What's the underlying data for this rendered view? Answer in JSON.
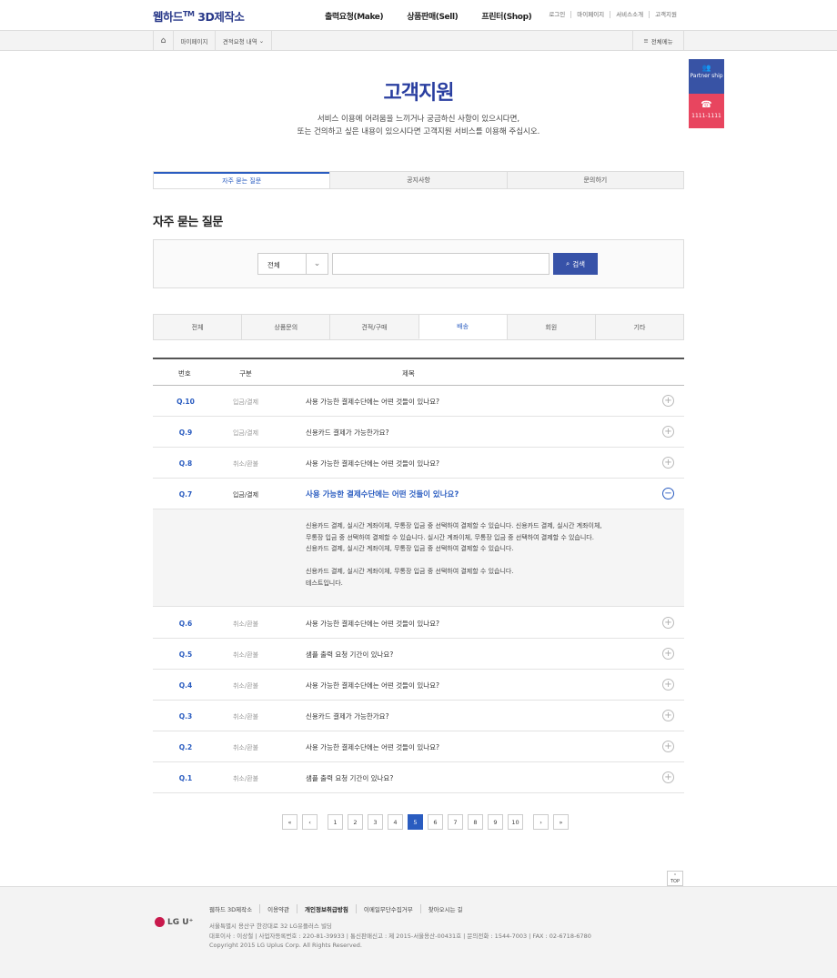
{
  "header": {
    "logo_main": "웹하드",
    "logo_tm": "TM",
    "logo_sub": "3D제작소",
    "gnb": [
      "출력요청(Make)",
      "상품판매(Sell)",
      "프린터(Shop)"
    ],
    "util": [
      "로그인",
      "마이페이지",
      "서비스소개",
      "고객지원"
    ]
  },
  "subbar": {
    "crumb1": "마이페이지",
    "crumb2": "견적요청 내역",
    "allmenu": "전체메뉴"
  },
  "side": {
    "partner": "Partner ship",
    "phone": "1111-1111"
  },
  "page": {
    "title": "고객지원",
    "desc1": "서비스 이용에 어려움을 느끼거나 궁금하신 사항이 있으시다면,",
    "desc2": "또는 건의하고 싶은 내용이 있으시다면 고객지원 서비스를 이용해 주십시오."
  },
  "tabs": [
    "자주 묻는 질문",
    "공지사항",
    "문의하기"
  ],
  "section_title": "자주 묻는 질문",
  "search": {
    "select_value": "전체",
    "input_value": "",
    "button": "검색"
  },
  "categories": [
    "전체",
    "상품문의",
    "견적/구매",
    "배송",
    "회원",
    "기타"
  ],
  "table": {
    "headers": [
      "번호",
      "구분",
      "제목"
    ],
    "rows": [
      {
        "no": "Q.10",
        "cat": "입금/결제",
        "q": "사용 가능한 결제수단에는 어떤 것들이 있나요?"
      },
      {
        "no": "Q.9",
        "cat": "입금/결제",
        "q": "신용카드 결제가 가능한가요?"
      },
      {
        "no": "Q.8",
        "cat": "취소/환불",
        "q": "사용 가능한 결제수단에는 어떤 것들이 있나요?"
      },
      {
        "no": "Q.7",
        "cat": "입금/결제",
        "q": "사용 가능한 결제수단에는 어떤 것들이 있나요?"
      },
      {
        "no": "Q.6",
        "cat": "취소/환불",
        "q": "사용 가능한 결제수단에는 어떤 것들이 있나요?"
      },
      {
        "no": "Q.5",
        "cat": "취소/환불",
        "q": "샘플 출력 요청 기간이 있나요?"
      },
      {
        "no": "Q.4",
        "cat": "취소/환불",
        "q": "사용 가능한 결제수단에는 어떤 것들이 있나요?"
      },
      {
        "no": "Q.3",
        "cat": "취소/환불",
        "q": "신용카드 결제가 가능한가요?"
      },
      {
        "no": "Q.2",
        "cat": "취소/환불",
        "q": "사용 가능한 결제수단에는 어떤 것들이 있나요?"
      },
      {
        "no": "Q.1",
        "cat": "취소/환불",
        "q": "샘플 출력 요청 기간이 있나요?"
      }
    ],
    "answer_lines": [
      "신용카드 결제, 실시간 계좌이체, 무통장 입금 중 선택하여 결제할 수 있습니다. 신용카드 결제, 실시간 계좌이체,",
      "무통장 입금 중 선택하여 결제할 수 있습니다. 실시간 계좌이체, 무통장 입금 중 선택하여 결제할 수 있습니다.",
      "신용카드 결제, 실시간 계좌이체, 무통장 입금 중 선택하여 결제할 수 있습니다.",
      "신용카드 결제, 실시간 계좌이체, 무통장 입금 중 선택하여 결제할 수 있습니다.",
      "테스트입니다."
    ]
  },
  "pager": {
    "pages": [
      "1",
      "2",
      "3",
      "4",
      "5",
      "6",
      "7",
      "8",
      "9",
      "10"
    ],
    "current": "5",
    "first": "«",
    "prev": "‹",
    "next": "›",
    "last": "»"
  },
  "top_label": "TOP",
  "footer": {
    "logo": "LG U⁺",
    "links": [
      "웹하드 3D제작소",
      "이용약관",
      "개인정보취급방침",
      "이메일무단수집거부",
      "찾아오시는 길"
    ],
    "addr1": "서울특별시 용산구 한강대로 32 LG유플러스 빌딩",
    "addr2": "대표이사 : 이상철   |   사업자등록번호 : 220-81-39933   |   통신판매신고 : 제 2015-서울용산-00431호   |   문의전화 : 1544-7003   |   FAX : 02-6718-6780",
    "copy": "Copyright 2015 LG Uplus Corp. All Rights Reserved."
  },
  "colors": {
    "accent": "#2a5cc0",
    "brand": "#3752a8",
    "call": "#e8455f"
  }
}
